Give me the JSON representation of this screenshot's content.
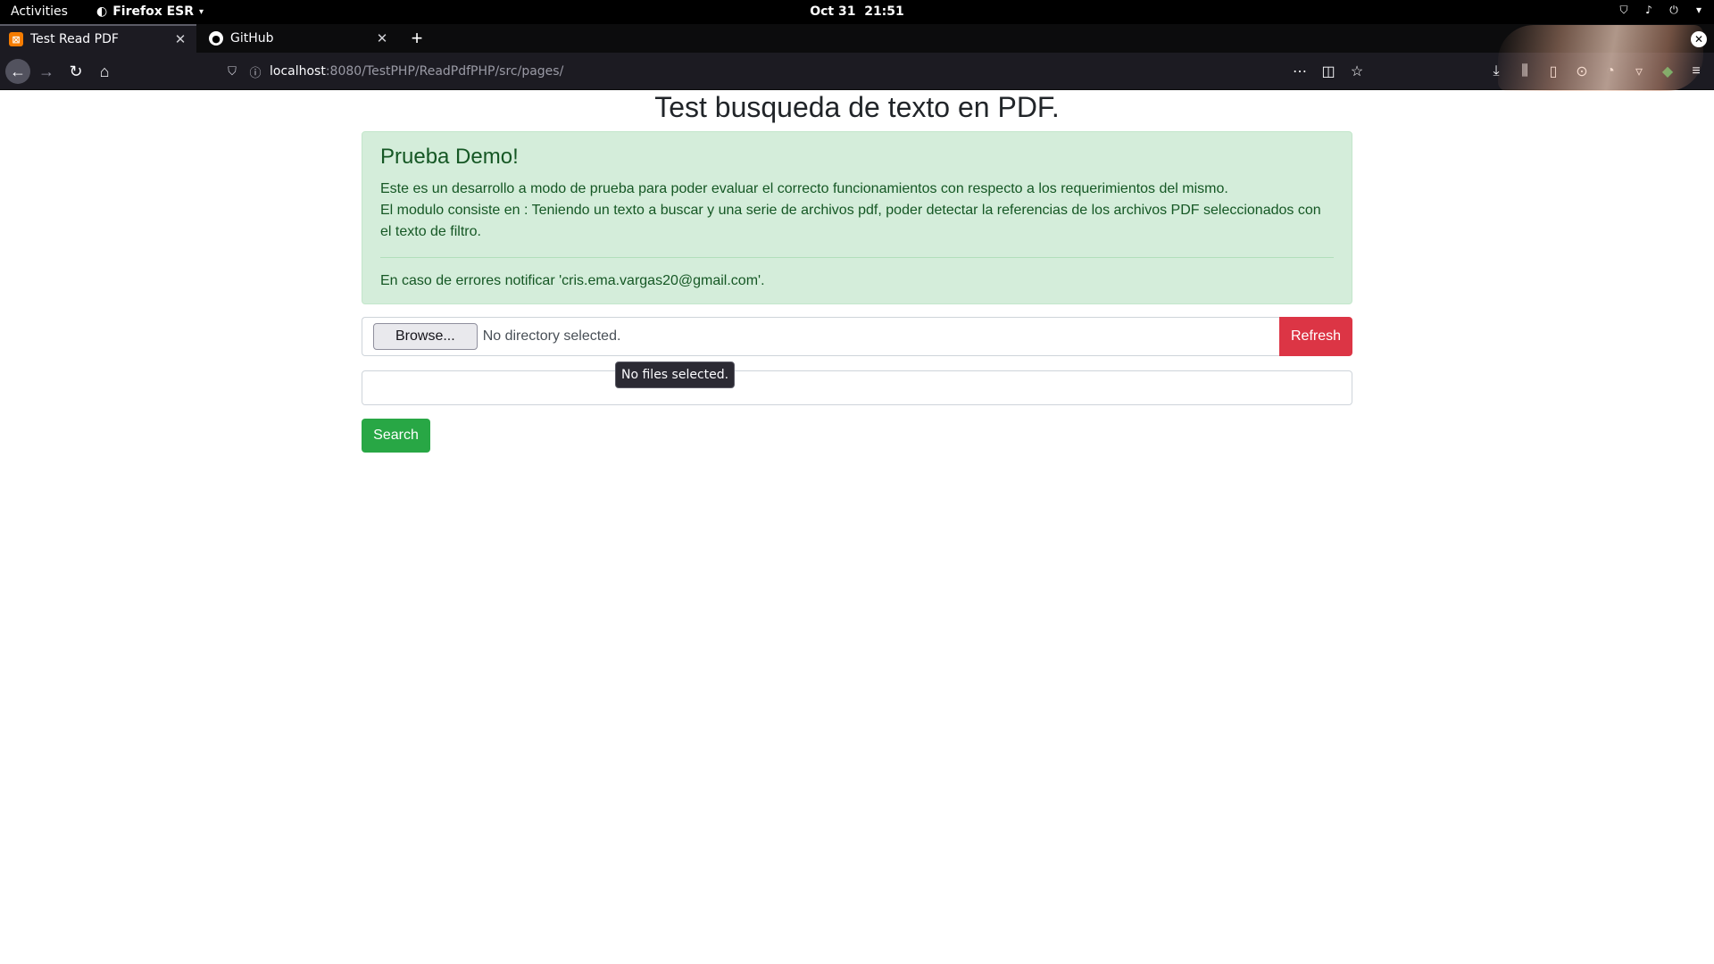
{
  "system_bar": {
    "activities": "Activities",
    "app_name": "Firefox ESR",
    "date": "Oct 31",
    "time": "21:51"
  },
  "tabs": [
    {
      "title": "Test Read PDF",
      "active": true,
      "icon": "pdf-favicon"
    },
    {
      "title": "GitHub",
      "active": false,
      "icon": "github-favicon"
    }
  ],
  "url": {
    "host": "localhost",
    "rest": ":8080/TestPHP/ReadPdfPHP/src/pages/"
  },
  "page": {
    "title": "Test busqueda de texto en PDF.",
    "alert": {
      "heading": "Prueba Demo!",
      "line1": "Este es un desarrollo a modo de prueba para poder evaluar el correcto funcionamientos con respecto a los requerimientos del mismo.",
      "line2": "El modulo consiste en : Teniendo un texto a buscar y una serie de archivos pdf, poder detectar la referencias de los archivos PDF seleccionados con el texto de filtro.",
      "footer": "En caso de errores notificar 'cris.ema.vargas20@gmail.com'."
    },
    "file_input": {
      "browse_label": "Browse...",
      "status": "No directory selected.",
      "tooltip": "No files selected."
    },
    "refresh_label": "Refresh",
    "search_input_value": "",
    "search_label": "Search"
  },
  "colors": {
    "alert_bg": "#d4edda",
    "alert_text": "#155724",
    "refresh": "#dc3545",
    "search": "#28a745"
  }
}
